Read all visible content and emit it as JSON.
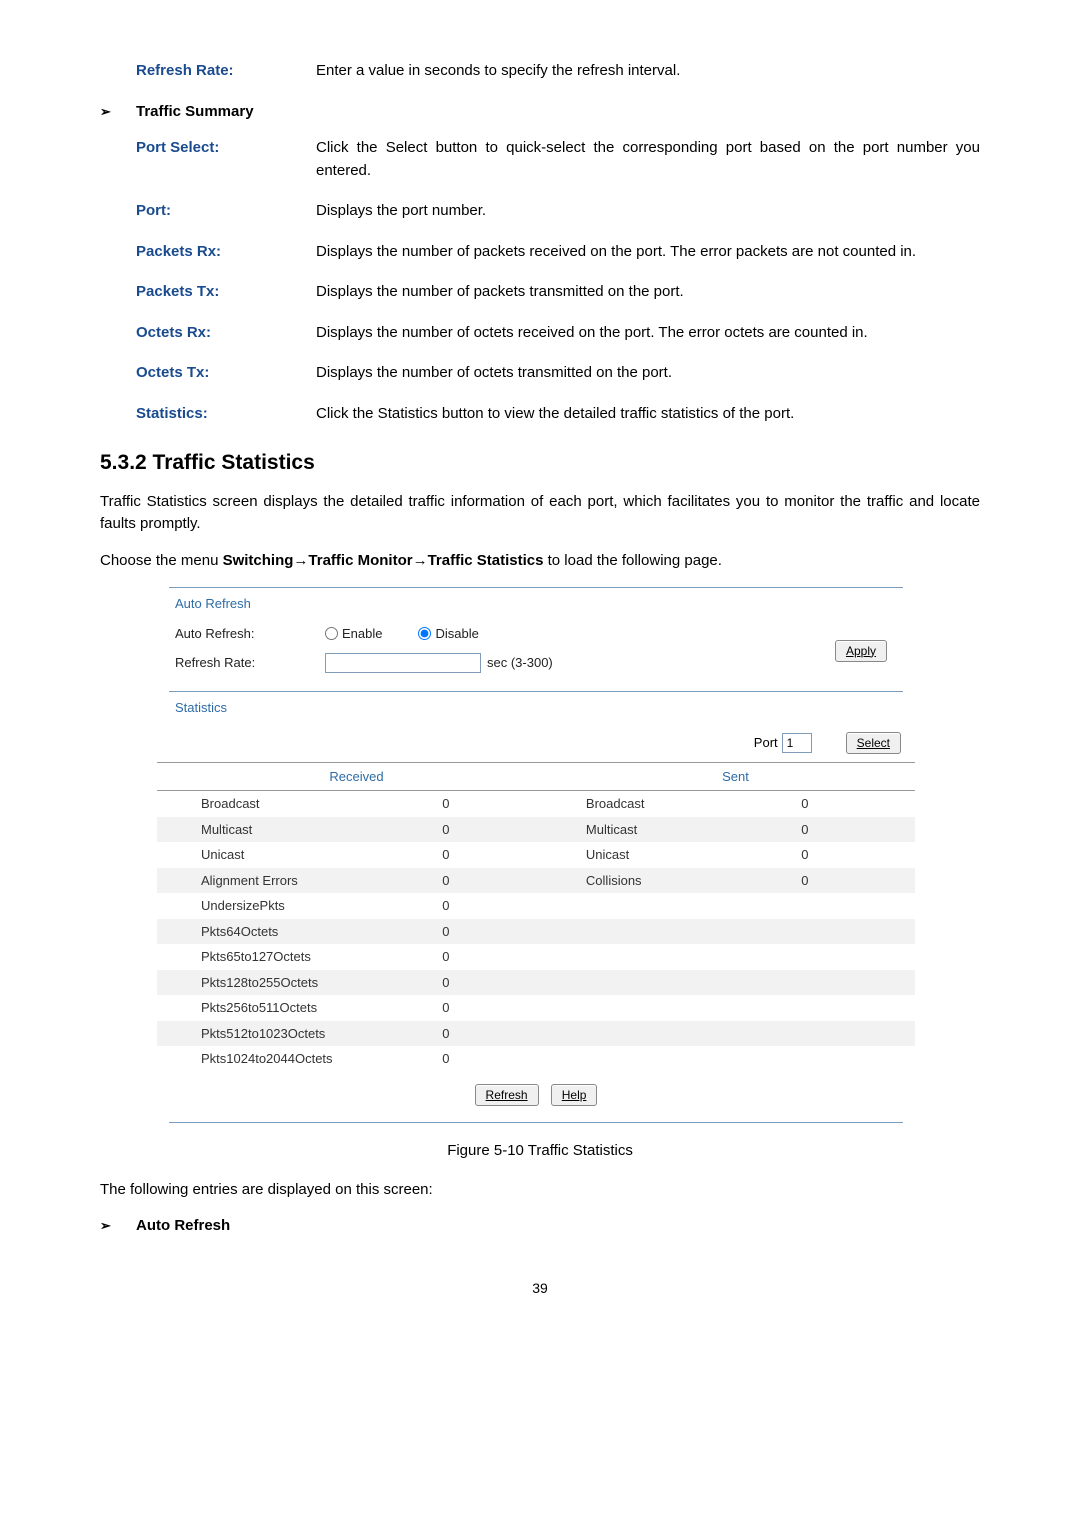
{
  "defs_top": {
    "refresh_rate_label": "Refresh Rate:",
    "refresh_rate_desc": "Enter a value in seconds to specify the refresh interval."
  },
  "traffic_summary_header": "Traffic Summary",
  "arrow": "➢",
  "defs": [
    {
      "label": "Port Select:",
      "desc": "Click the Select button to quick-select the corresponding port based on the port number you entered."
    },
    {
      "label": "Port:",
      "desc": "Displays the port number."
    },
    {
      "label": "Packets Rx:",
      "desc": "Displays the number of packets received on the port. The error packets are not counted in."
    },
    {
      "label": "Packets Tx:",
      "desc": "Displays the number of packets transmitted on the port."
    },
    {
      "label": "Octets Rx:",
      "desc": "Displays the number of octets received on the port. The error octets are counted in."
    },
    {
      "label": "Octets Tx:",
      "desc": "Displays the number of octets transmitted on the port."
    },
    {
      "label": "Statistics:",
      "desc": "Click the Statistics button to view the detailed traffic statistics of the port."
    }
  ],
  "h3": "5.3.2 Traffic Statistics",
  "para1": "Traffic Statistics screen displays the detailed traffic information of each port, which facilitates you to monitor the traffic and locate faults promptly.",
  "para2_prefix": "Choose the menu ",
  "para2_bold": "Switching→Traffic Monitor→Traffic Statistics",
  "para2_suffix": " to load the following page.",
  "panel": {
    "auto_refresh_title": "Auto Refresh",
    "auto_refresh_label": "Auto Refresh:",
    "refresh_rate_label": "Refresh Rate:",
    "enable": "Enable",
    "disable": "Disable",
    "sec_suffix": "sec (3-300)",
    "apply": "Apply",
    "statistics_title": "Statistics",
    "port_label": "Port",
    "port_value": "1",
    "select": "Select",
    "received": "Received",
    "sent": "Sent",
    "rows": [
      {
        "lname": "Broadcast",
        "lval": "0",
        "rname": "Broadcast",
        "rval": "0"
      },
      {
        "lname": "Multicast",
        "lval": "0",
        "rname": "Multicast",
        "rval": "0"
      },
      {
        "lname": "Unicast",
        "lval": "0",
        "rname": "Unicast",
        "rval": "0"
      },
      {
        "lname": "Alignment Errors",
        "lval": "0",
        "rname": "Collisions",
        "rval": "0"
      },
      {
        "lname": "UndersizePkts",
        "lval": "0",
        "rname": "",
        "rval": ""
      },
      {
        "lname": "Pkts64Octets",
        "lval": "0",
        "rname": "",
        "rval": ""
      },
      {
        "lname": "Pkts65to127Octets",
        "lval": "0",
        "rname": "",
        "rval": ""
      },
      {
        "lname": "Pkts128to255Octets",
        "lval": "0",
        "rname": "",
        "rval": ""
      },
      {
        "lname": "Pkts256to511Octets",
        "lval": "0",
        "rname": "",
        "rval": ""
      },
      {
        "lname": "Pkts512to1023Octets",
        "lval": "0",
        "rname": "",
        "rval": ""
      },
      {
        "lname": "Pkts1024to2044Octets",
        "lval": "0",
        "rname": "",
        "rval": ""
      }
    ],
    "refresh_btn": "Refresh",
    "help_btn": "Help"
  },
  "caption": "Figure 5-10 Traffic Statistics",
  "following_entries": "The following entries are displayed on this screen:",
  "auto_refresh_header": "Auto Refresh",
  "pagenum": "39"
}
